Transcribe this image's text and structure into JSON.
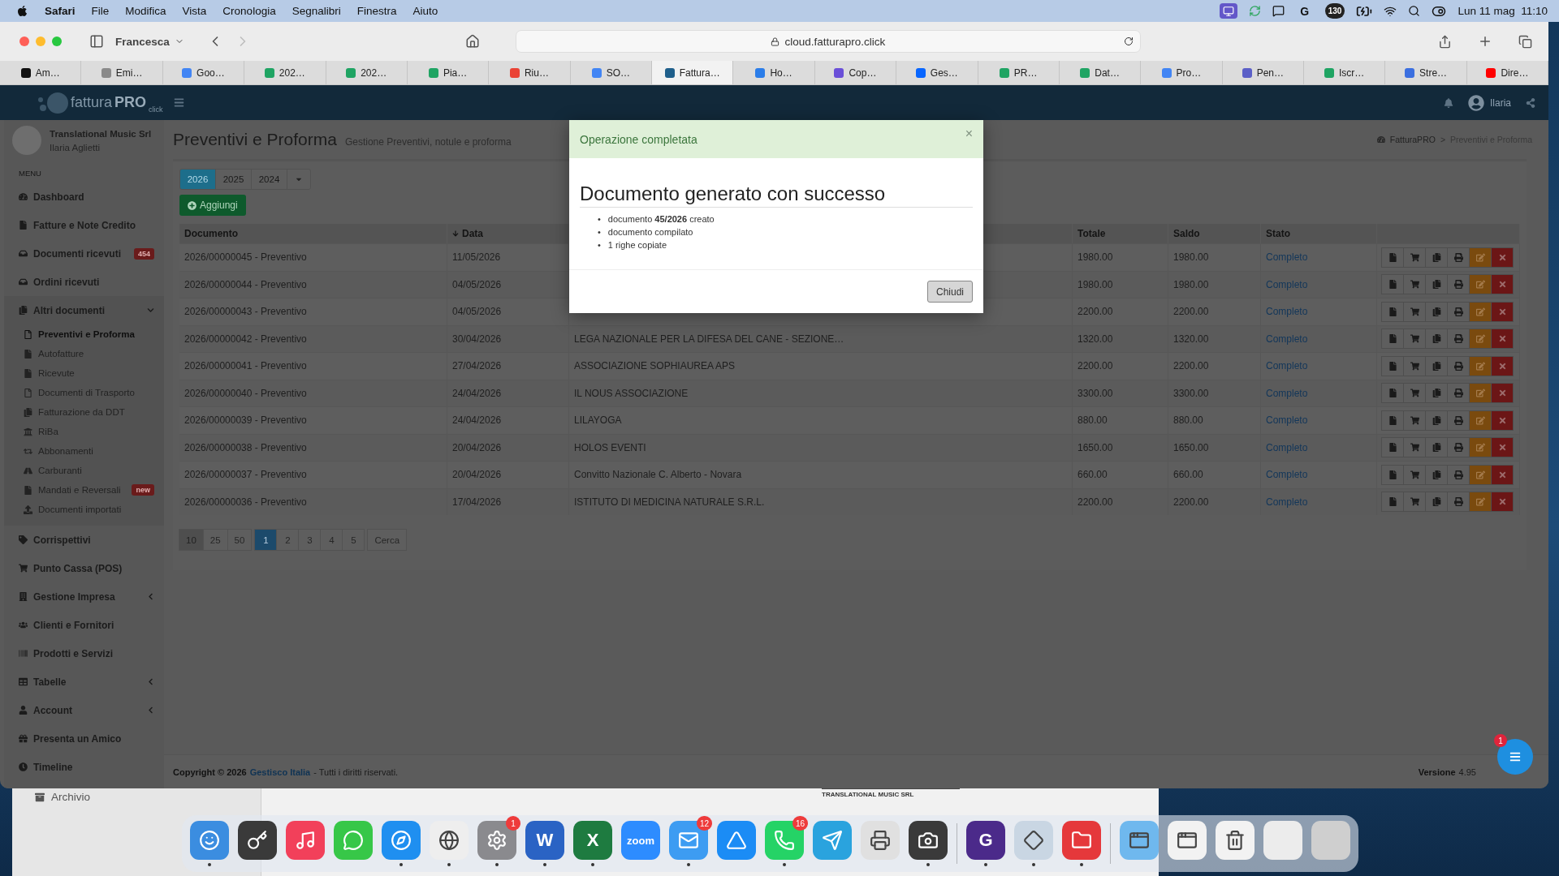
{
  "menu_bar": {
    "app": "Safari",
    "items": [
      "File",
      "Modifica",
      "Vista",
      "Cronologia",
      "Segnalibri",
      "Finestra",
      "Aiuto"
    ],
    "status_icons": [
      {
        "kind": "screen"
      },
      {
        "kind": "sync"
      },
      {
        "kind": "chat"
      },
      {
        "kind": "letter",
        "label": "G"
      },
      {
        "kind": "counter",
        "label": "130"
      },
      {
        "kind": "battery"
      },
      {
        "kind": "wifi"
      },
      {
        "kind": "search"
      },
      {
        "kind": "control"
      }
    ],
    "clock": "Lun 11 mag  11:10"
  },
  "browser": {
    "profile": "Francesca",
    "back_disabled": false,
    "forward_disabled": true,
    "address": "cloud.fatturapro.click",
    "tabs": [
      {
        "label": "Am…",
        "color": "#111111",
        "selected": false
      },
      {
        "label": "Emi…",
        "color": "#8a8a8a",
        "selected": false
      },
      {
        "label": "Goo…",
        "color": "#4285f4",
        "selected": false
      },
      {
        "label": "202…",
        "color": "#1fa463",
        "selected": false
      },
      {
        "label": "202…",
        "color": "#1fa463",
        "selected": false
      },
      {
        "label": "Pia…",
        "color": "#1fa463",
        "selected": false
      },
      {
        "label": "Riu…",
        "color": "#ea4335",
        "selected": false
      },
      {
        "label": "SO…",
        "color": "#4285f4",
        "selected": false
      },
      {
        "label": "Fattura…",
        "color": "#1f5f8b",
        "selected": true
      },
      {
        "label": "Ho…",
        "color": "#2b7de9",
        "selected": false
      },
      {
        "label": "Cop…",
        "color": "#6a4fd8",
        "selected": false
      },
      {
        "label": "Ges…",
        "color": "#0866ff",
        "selected": false
      },
      {
        "label": "PR…",
        "color": "#1fa463",
        "selected": false
      },
      {
        "label": "Dat…",
        "color": "#1fa463",
        "selected": false
      },
      {
        "label": "Pro…",
        "color": "#4285f4",
        "selected": false
      },
      {
        "label": "Pen…",
        "color": "#5b5fc7",
        "selected": false
      },
      {
        "label": "Iscr…",
        "color": "#1fa463",
        "selected": false
      },
      {
        "label": "Stre…",
        "color": "#3b6fe0",
        "selected": false
      },
      {
        "label": "Dire…",
        "color": "#ff0000",
        "selected": false
      }
    ]
  },
  "navbar": {
    "logo_word": "fattura",
    "logo_strong": "PRO",
    "logo_sub": "click",
    "user": "Ilaria"
  },
  "sidebar": {
    "company": "Translational Music Srl",
    "user": "Ilaria Aglietti",
    "menu_label": "MENU",
    "items": [
      {
        "kind": "link",
        "label": "Dashboard"
      },
      {
        "kind": "link",
        "label": "Fatture e Note Credito"
      },
      {
        "kind": "link",
        "label": "Documenti ricevuti",
        "badge": "454"
      },
      {
        "kind": "link",
        "label": "Ordini ricevuti"
      },
      {
        "kind": "group",
        "label": "Altri documenti",
        "expanded": true,
        "children": [
          {
            "label": "Preventivi e Proforma",
            "selected": true
          },
          {
            "label": "Autofatture",
            "selected": false
          },
          {
            "label": "Ricevute",
            "selected": false
          },
          {
            "label": "Documenti di Trasporto",
            "selected": false
          },
          {
            "label": "Fatturazione da DDT",
            "selected": false
          },
          {
            "label": "RiBa",
            "selected": false
          },
          {
            "label": "Abbonamenti",
            "selected": false
          },
          {
            "label": "Carburanti",
            "selected": false
          },
          {
            "label": "Mandati e Reversali",
            "selected": false,
            "badge": "new"
          },
          {
            "label": "Documenti importati",
            "selected": false
          }
        ]
      },
      {
        "kind": "link",
        "label": "Corrispettivi"
      },
      {
        "kind": "link",
        "label": "Punto Cassa (POS)"
      },
      {
        "kind": "group",
        "label": "Gestione Impresa",
        "expanded": false
      },
      {
        "kind": "link",
        "label": "Clienti e Fornitori"
      },
      {
        "kind": "link",
        "label": "Prodotti e Servizi"
      },
      {
        "kind": "group",
        "label": "Tabelle",
        "expanded": false
      },
      {
        "kind": "group",
        "label": "Account",
        "expanded": false
      },
      {
        "kind": "link",
        "label": "Presenta un Amico"
      },
      {
        "kind": "link",
        "label": "Timeline"
      }
    ]
  },
  "page": {
    "title": "Preventivi e Proforma",
    "subtitle": "Gestione Preventivi, notule e proforma",
    "breadcrumb": [
      "FatturaPRO",
      "Preventivi e Proforma"
    ],
    "breadcrumb_separator": ">",
    "year_tabs": [
      {
        "label": "2026",
        "selected": true
      },
      {
        "label": "2025",
        "selected": false
      },
      {
        "label": "2024",
        "selected": false
      }
    ],
    "add_button": "Aggiungi",
    "columns": [
      {
        "label": "Documento",
        "sorted": false
      },
      {
        "label": "Data",
        "sorted": true
      },
      {
        "label": "Totale",
        "sorted": false
      },
      {
        "label": "Saldo",
        "sorted": false
      },
      {
        "label": "Stato",
        "sorted": false
      }
    ],
    "rows": [
      {
        "document": "2026/00000045 - Preventivo",
        "date": "11/05/2026",
        "total": "1980.00",
        "balance": "1980.00",
        "status": "Completo"
      },
      {
        "document": "2026/00000044 - Preventivo",
        "date": "04/05/2026",
        "total": "1980.00",
        "balance": "1980.00",
        "status": "Completo"
      },
      {
        "document": "2026/00000043 - Preventivo",
        "date": "04/05/2026",
        "total": "2200.00",
        "balance": "2200.00",
        "status": "Completo"
      },
      {
        "document": "2026/00000042 - Preventivo",
        "date": "30/04/2026",
        "client": "LEGA NAZIONALE PER LA DIFESA DEL CANE - SEZIONE…",
        "total": "1320.00",
        "balance": "1320.00",
        "status": "Completo"
      },
      {
        "document": "2026/00000041 - Preventivo",
        "date": "27/04/2026",
        "client": "ASSOCIAZIONE SOPHIAUREA APS",
        "total": "2200.00",
        "balance": "2200.00",
        "status": "Completo"
      },
      {
        "document": "2026/00000040 - Preventivo",
        "date": "24/04/2026",
        "client": "IL NOUS ASSOCIAZIONE",
        "total": "3300.00",
        "balance": "3300.00",
        "status": "Completo"
      },
      {
        "document": "2026/00000039 - Preventivo",
        "date": "24/04/2026",
        "client": "LILAYOGA",
        "total": "880.00",
        "balance": "880.00",
        "status": "Completo"
      },
      {
        "document": "2026/00000038 - Preventivo",
        "date": "20/04/2026",
        "client": "HOLOS EVENTI",
        "total": "1650.00",
        "balance": "1650.00",
        "status": "Completo"
      },
      {
        "document": "2026/00000037 - Preventivo",
        "date": "20/04/2026",
        "client": "Convitto Nazionale C. Alberto - Novara",
        "total": "660.00",
        "balance": "660.00",
        "status": "Completo"
      },
      {
        "document": "2026/00000036 - Preventivo",
        "date": "17/04/2026",
        "client": "ISTITUTO DI MEDICINA NATURALE S.R.L.",
        "total": "2200.00",
        "balance": "2200.00",
        "status": "Completo"
      }
    ],
    "page_sizes": [
      {
        "label": "10",
        "selected": true
      },
      {
        "label": "25",
        "selected": false
      },
      {
        "label": "50",
        "selected": false
      }
    ],
    "pages": [
      {
        "label": "1",
        "selected": true
      },
      {
        "label": "2",
        "selected": false
      },
      {
        "label": "3",
        "selected": false
      },
      {
        "label": "4",
        "selected": false
      },
      {
        "label": "5",
        "selected": false
      }
    ],
    "search_button": "Cerca"
  },
  "footer": {
    "copyright": "Copyright © 2026",
    "link": "Gestisco Italia",
    "rights": "- Tutti i diritti riservati.",
    "version_label": "Versione",
    "version": "4.95"
  },
  "chat_badge": "1",
  "modal": {
    "title": "Operazione completata",
    "close": "×",
    "heading": "Documento generato con successo",
    "bullet": "•",
    "items": [
      "documento **45/2026** creato",
      "documento compilato",
      "1 righe copiate"
    ],
    "button": "Chiudi"
  },
  "background_window": {
    "sidebar_item": "Archivio",
    "document_heading": "TRANSLATIONAL MUSIC SRL"
  },
  "dock": {
    "apps": [
      {
        "kind": "app",
        "color": "#3b8de0",
        "running": true
      },
      {
        "kind": "app",
        "color": "#3a3a3a",
        "running": false
      },
      {
        "kind": "app",
        "color": "#f2405a",
        "running": false
      },
      {
        "kind": "app",
        "color": "#37c748",
        "running": false
      },
      {
        "kind": "app",
        "color": "#1f8ff0",
        "running": true
      },
      {
        "kind": "app",
        "color": "#eeeeee",
        "running": true
      },
      {
        "kind": "app",
        "color": "#8a8a8e",
        "running": true,
        "badge": "1"
      },
      {
        "kind": "app",
        "color": "#2a63c4",
        "running": true,
        "label": "W"
      },
      {
        "kind": "app",
        "color": "#1e7b40",
        "running": true,
        "label": "X"
      },
      {
        "kind": "app",
        "color": "#2d8cff",
        "running": false,
        "label": "zoom"
      },
      {
        "kind": "app",
        "color": "#3d9cf2",
        "running": true,
        "badge": "12"
      },
      {
        "kind": "app",
        "color": "#1b8cf5",
        "running": false
      },
      {
        "kind": "app",
        "color": "#25d366",
        "running": true,
        "badge": "16"
      },
      {
        "kind": "app",
        "color": "#2aa3de",
        "running": false
      },
      {
        "kind": "app",
        "color": "#e0e0e0",
        "running": false
      },
      {
        "kind": "app",
        "color": "#3a3a3a",
        "running": true
      },
      {
        "kind": "separator"
      },
      {
        "kind": "app",
        "color": "#4b2a8a",
        "running": true,
        "label": "G"
      },
      {
        "kind": "app",
        "color": "#c9d6e3",
        "running": true
      },
      {
        "kind": "app",
        "color": "#e5383b",
        "running": true
      },
      {
        "kind": "separator"
      },
      {
        "kind": "app",
        "color": "#6fb8ee",
        "running": false
      },
      {
        "kind": "app",
        "color": "#f2f2f2",
        "running": false
      },
      {
        "kind": "app",
        "color": "#f2f2f2",
        "running": false
      },
      {
        "kind": "app",
        "color": "#ececec",
        "running": false
      },
      {
        "kind": "app",
        "color": "#cfcfcf",
        "running": false
      }
    ]
  }
}
